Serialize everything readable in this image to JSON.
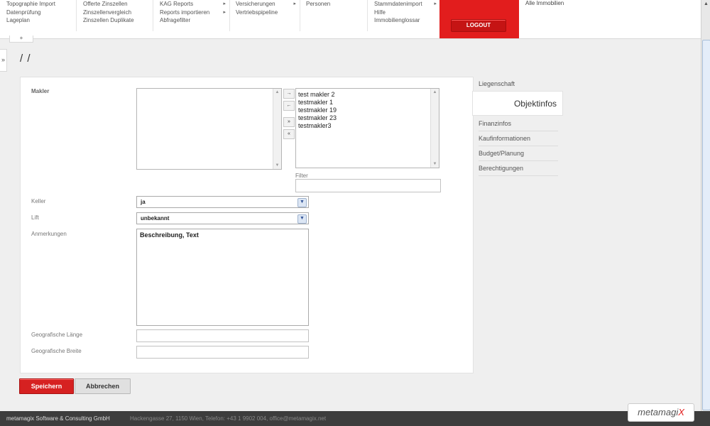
{
  "menu": {
    "columns": [
      {
        "items": [
          {
            "label": "Topographie Import",
            "sub": false
          },
          {
            "label": "Datenprüfung",
            "sub": false
          },
          {
            "label": "Lageplan",
            "sub": false
          }
        ]
      },
      {
        "items": [
          {
            "label": "Offerte Zinszellen",
            "sub": false
          },
          {
            "label": "Zinszellenvergleich",
            "sub": false
          },
          {
            "label": "Zinszellen Duplikate",
            "sub": false
          }
        ]
      },
      {
        "items": [
          {
            "label": "KAG Reports",
            "sub": true
          },
          {
            "label": "Reports importieren",
            "sub": true
          },
          {
            "label": "Abfragefilter",
            "sub": false
          }
        ]
      },
      {
        "items": [
          {
            "label": "Versicherungen",
            "sub": true
          },
          {
            "label": "Vertriebspipeline",
            "sub": false
          }
        ]
      },
      {
        "items": [
          {
            "label": "Personen",
            "sub": false
          }
        ]
      },
      {
        "items": [
          {
            "label": "Stammdatenimport",
            "sub": true
          },
          {
            "label": "Hilfe",
            "sub": false
          },
          {
            "label": "Immobilienglossar",
            "sub": false
          }
        ]
      }
    ],
    "logout_label": "LOGOUT",
    "all_label": "Alle Immobilien",
    "nav_toggle": "+"
  },
  "side_handle": "»",
  "page": {
    "title": "/ /"
  },
  "form": {
    "makler_label": "Makler",
    "makler_selected": [
      "test makler 2",
      "testmakler 1",
      "testmakler 19",
      "testmakler 23",
      "testmakler3"
    ],
    "move_buttons": [
      "→",
      "←",
      "»",
      "«"
    ],
    "filter_label": "Filter",
    "filter_value": "",
    "keller_label": "Keller",
    "keller_value": "ja",
    "lift_label": "Lift",
    "lift_value": "unbekannt",
    "anmerkungen_label": "Anmerkungen",
    "anmerkungen_value": "Beschreibung, Text",
    "laenge_label": "Geografische Länge",
    "laenge_value": "",
    "breite_label": "Geografische Breite",
    "breite_value": ""
  },
  "tabs": [
    "Liegenschaft",
    "Objektinfos",
    "Finanzinfos",
    "Kaufinformationen",
    "Budget/Planung",
    "Berechtigungen"
  ],
  "active_tab": "Objektinfos",
  "buttons": {
    "save": "Speichern",
    "cancel": "Abbrechen"
  },
  "footer": {
    "company": "metamagix Software & Consulting GmbH",
    "address": "Hackengasse 27, 1150 Wien, Telefon: +43 1 9902 004, office@metamagix.net",
    "logo_main": "metamagi",
    "logo_accent": "X"
  },
  "colors": {
    "brand_red": "#e21d1d",
    "background": "#efefef",
    "footer": "#3d3d3d"
  }
}
